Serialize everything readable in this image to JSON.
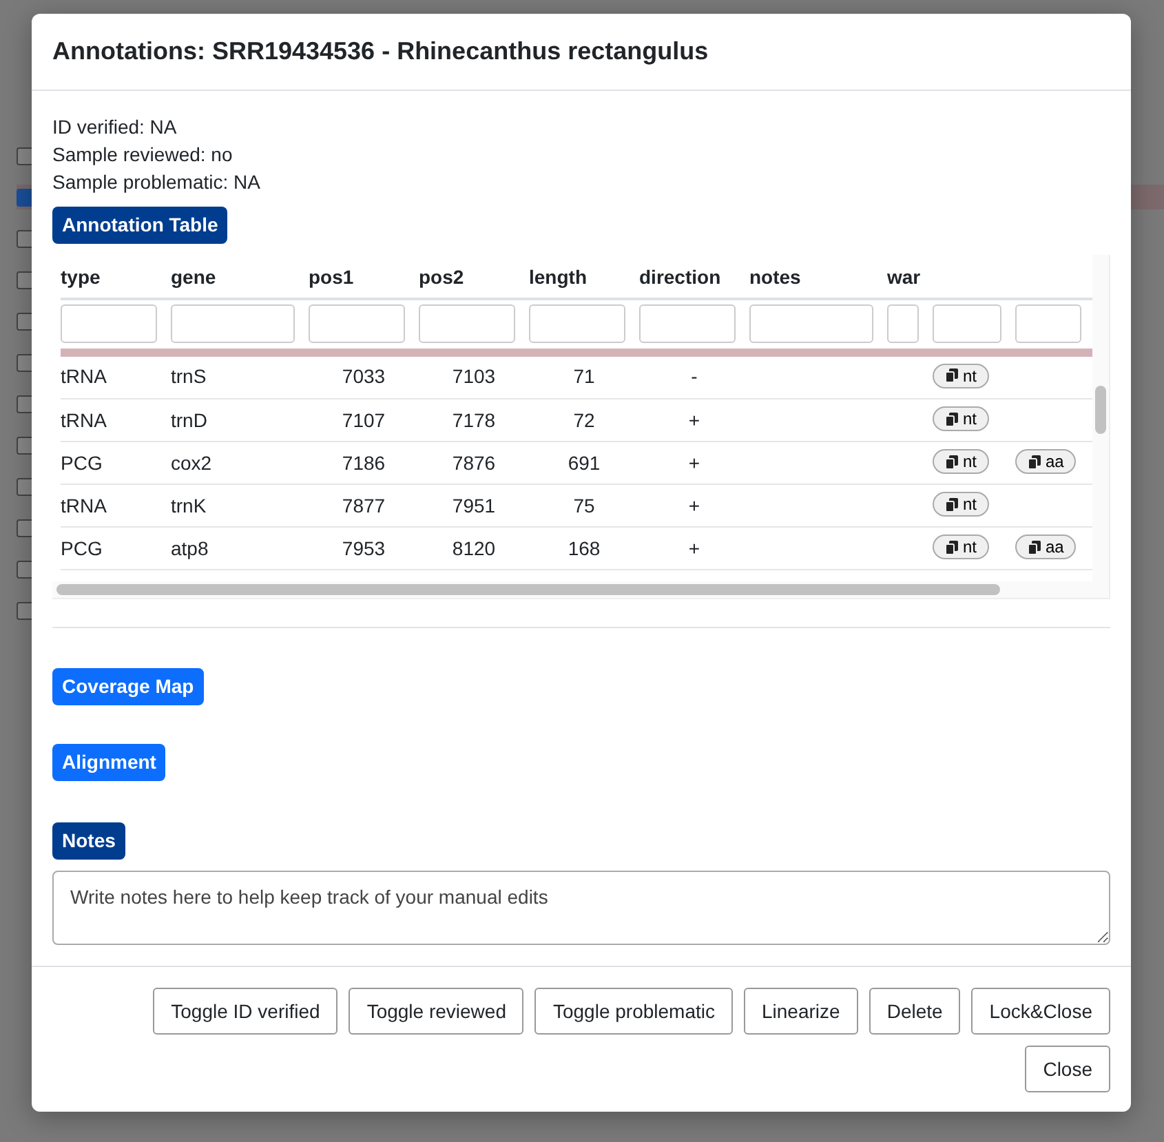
{
  "background": {
    "rows": [
      {
        "checked": false
      },
      {
        "checked": true
      },
      {
        "checked": false
      },
      {
        "checked": false
      },
      {
        "checked": false
      },
      {
        "checked": false
      },
      {
        "checked": false
      },
      {
        "checked": false
      },
      {
        "checked": false
      },
      {
        "checked": false
      },
      {
        "checked": false
      },
      {
        "checked": false
      }
    ]
  },
  "dialog": {
    "title": "Annotations: SRR19434536 - Rhinecanthus rectangulus",
    "info": [
      "ID verified: NA",
      "Sample reviewed: no",
      "Sample problematic: NA"
    ],
    "sections": [
      {
        "kind": "table",
        "label": "Annotation Table",
        "expanded": true,
        "columns": [
          "type",
          "gene",
          "pos1",
          "pos2",
          "length",
          "direction",
          "notes",
          "war"
        ],
        "rows": [
          {
            "type": "tRNA",
            "gene": "trnS",
            "pos1": "7033",
            "pos2": "7103",
            "length": "71",
            "direction": "-",
            "copy": [
              "nt"
            ]
          },
          {
            "type": "tRNA",
            "gene": "trnD",
            "pos1": "7107",
            "pos2": "7178",
            "length": "72",
            "direction": "+",
            "copy": [
              "nt"
            ]
          },
          {
            "type": "PCG",
            "gene": "cox2",
            "pos1": "7186",
            "pos2": "7876",
            "length": "691",
            "direction": "+",
            "copy": [
              "nt",
              "aa"
            ]
          },
          {
            "type": "tRNA",
            "gene": "trnK",
            "pos1": "7877",
            "pos2": "7951",
            "length": "75",
            "direction": "+",
            "copy": [
              "nt"
            ]
          },
          {
            "type": "PCG",
            "gene": "atp8",
            "pos1": "7953",
            "pos2": "8120",
            "length": "168",
            "direction": "+",
            "copy": [
              "nt",
              "aa"
            ]
          }
        ]
      },
      {
        "kind": "plain",
        "label": "Coverage Map",
        "expanded": false
      },
      {
        "kind": "plain",
        "label": "Alignment",
        "expanded": false
      },
      {
        "kind": "notes",
        "label": "Notes",
        "expanded": true,
        "placeholder": "Write notes here to help keep track of your manual edits"
      }
    ],
    "buttons": [
      "Toggle ID verified",
      "Toggle reviewed",
      "Toggle problematic",
      "Linearize",
      "Delete",
      "Lock&Close",
      "Close"
    ]
  }
}
